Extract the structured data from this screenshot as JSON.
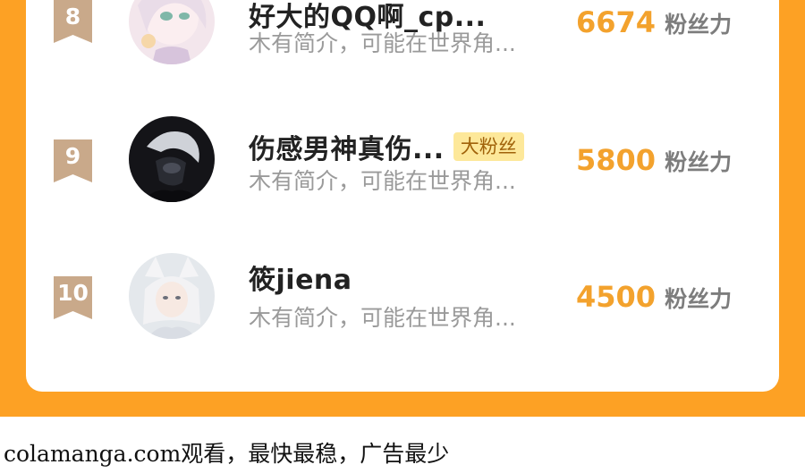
{
  "colors": {
    "background_orange": "#fda124",
    "card": "#ffffff",
    "rank_badge": "#c9a98a",
    "score": "#f3a22d",
    "fan_badge_bg": "#fde89a",
    "fan_badge_text": "#a0620a"
  },
  "ranking": [
    {
      "rank": "8",
      "name": "好大的QQ啊_cp...",
      "badge": "",
      "intro": "木有简介，可能在世界角...",
      "score": "6674",
      "score_unit": "粉丝力",
      "avatar_icon": "anime-girl-avatar"
    },
    {
      "rank": "9",
      "name": "伤感男神真伤...",
      "badge": "大粉丝",
      "intro": "木有简介，可能在世界角...",
      "score": "5800",
      "score_unit": "粉丝力",
      "avatar_icon": "dark-anime-avatar"
    },
    {
      "rank": "10",
      "name": "筱jiena",
      "badge": "",
      "intro": "木有简介，可能在世界角...",
      "score": "4500",
      "score_unit": "粉丝力",
      "avatar_icon": "fox-spirit-avatar"
    }
  ],
  "footer": {
    "text": "colamanga.com观看，最快最稳，广告最少"
  }
}
